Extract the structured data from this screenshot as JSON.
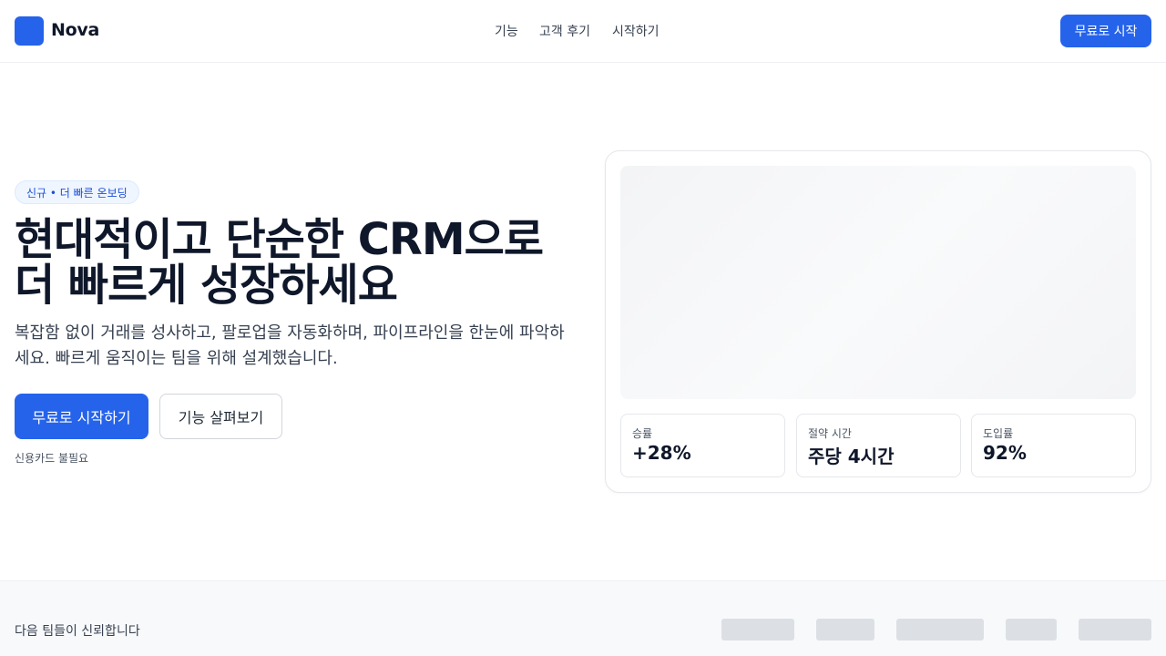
{
  "header": {
    "brand": "Nova",
    "nav": [
      "기능",
      "고객 후기",
      "시작하기"
    ],
    "cta_label": "무료로 시작"
  },
  "hero": {
    "badge": "신규 • 더 빠른 온보딩",
    "title_lines": [
      "현대적이고 단순한 CRM으로",
      "더 빠르게 성장하세요"
    ],
    "subtitle": "복잡함 없이 거래를 성사하고, 팔로업을 자동화하며, 파이프라인을 한눈에 파악하세요. 빠르게 움직이는 팀을 위해 설계했습니다.",
    "primary_cta": "무료로 시작하기",
    "secondary_cta": "기능 살펴보기",
    "note": "신용카드 불필요"
  },
  "stats": [
    {
      "label": "승률",
      "value": "+28%"
    },
    {
      "label": "절약 시간",
      "value": "주당 4시간"
    },
    {
      "label": "도입률",
      "value": "92%"
    }
  ],
  "trust": {
    "label": "다음 팀들이 신뢰합니다",
    "logo_count": 5
  },
  "colors": {
    "accent": "#2563eb",
    "text": "#0f172a",
    "muted": "#4b5563",
    "border": "#e5e7eb",
    "placeholder": "#dcdfe4"
  }
}
